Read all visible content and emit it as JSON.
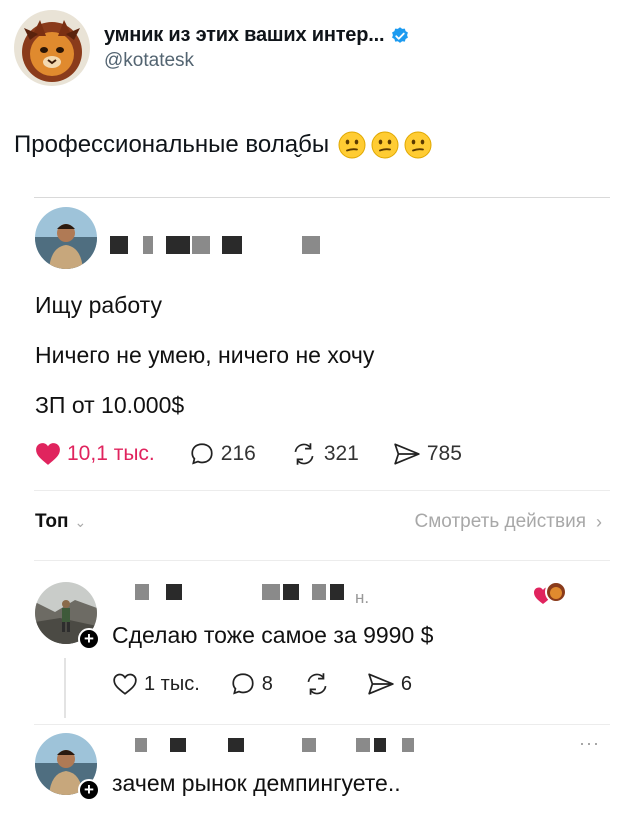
{
  "author": {
    "display_name": "умник из этих ваших интер...",
    "handle": "@kotatesk",
    "avatar_icon": "cat-avatar-icon",
    "verified_icon": "verified-badge-icon",
    "verified_color": "#1d9bf0"
  },
  "tweet": {
    "text": "Профессиональные вола̬бы",
    "emojis": [
      "confused-face-icon",
      "confused-face-icon",
      "confused-face-icon"
    ]
  },
  "embedded_post": {
    "avatar_icon": "man-avatar-icon",
    "lines": [
      "Ищу работу",
      "Ничего не умею, ничего не хочу",
      "ЗП от 10.000$"
    ],
    "actions": {
      "likes": "10,1 тыс.",
      "replies": "216",
      "reposts": "321",
      "shares": "785"
    },
    "like_color": "#e0245e",
    "sort_label": "Топ",
    "view_activity": "Смотреть действия"
  },
  "replies": [
    {
      "avatar_icon": "hiker-avatar-icon",
      "suffix": "н.",
      "text": "Сделаю тоже самое за 9990 $",
      "actions": {
        "likes": "1 тыс.",
        "replies": "8",
        "shares": "6"
      }
    },
    {
      "avatar_icon": "man-avatar-icon",
      "text": "зачем рынок демпингуете..",
      "more": "···"
    }
  ]
}
